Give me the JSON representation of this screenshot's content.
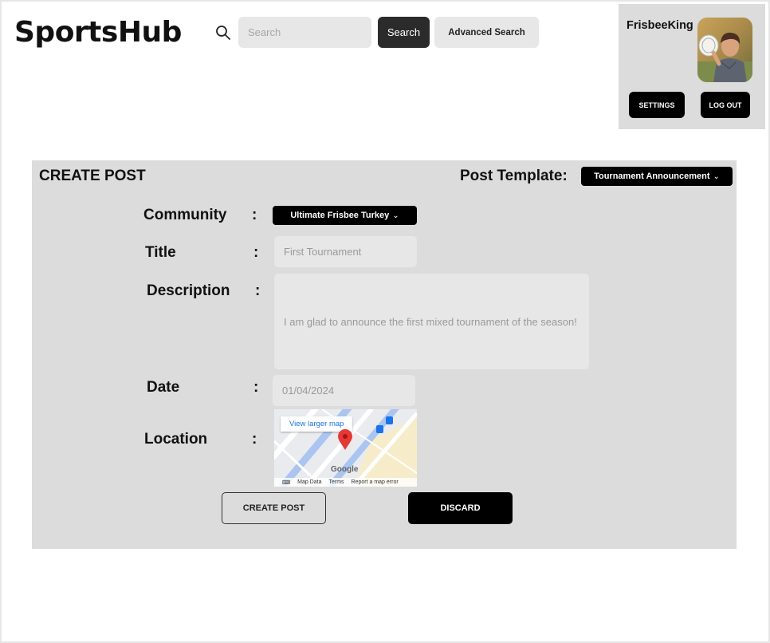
{
  "header": {
    "logo": "SportsHub",
    "search": {
      "placeholder": "Search",
      "button_label": "Search"
    },
    "advanced_search_label": "Advanced Search"
  },
  "user": {
    "name": "FrisbeeKing",
    "settings_label": "SETTINGS",
    "logout_label": "LOG OUT"
  },
  "create_post": {
    "title": "CREATE POST",
    "template_label": "Post Template:",
    "template_value": "Tournament Announcement",
    "fields": {
      "community": {
        "label": "Community",
        "value": "Ultimate Frisbee Turkey"
      },
      "title": {
        "label": "Title",
        "value": "First Tournament"
      },
      "description": {
        "label": "Description",
        "value": "I am glad to announce the first mixed tournament of the season!"
      },
      "date": {
        "label": "Date",
        "value": "01/04/2024"
      },
      "location": {
        "label": "Location"
      }
    },
    "colon": ":",
    "map": {
      "link_label": "View larger map",
      "logo": "Google",
      "footer": [
        "Map Data",
        "Terms",
        "Report a map error"
      ]
    },
    "create_label": "CREATE POST",
    "discard_label": "DISCARD"
  },
  "colors": {
    "panel_bg": "#dcdcdc",
    "input_bg": "#e7e7e7",
    "dark_button": "#2b2b2b",
    "black": "#000000",
    "map_pin": "#e53935"
  }
}
